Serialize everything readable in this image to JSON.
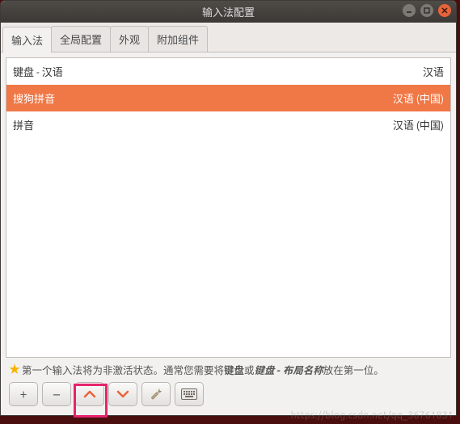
{
  "window": {
    "title": "输入法配置"
  },
  "tabs": [
    {
      "label": "输入法",
      "active": true
    },
    {
      "label": "全局配置",
      "active": false
    },
    {
      "label": "外观",
      "active": false
    },
    {
      "label": "附加组件",
      "active": false
    }
  ],
  "list": [
    {
      "name": "键盘 - 汉语",
      "lang": "汉语",
      "selected": false
    },
    {
      "name": "搜狗拼音",
      "lang": "汉语 (中国)",
      "selected": true
    },
    {
      "name": "拼音",
      "lang": "汉语 (中国)",
      "selected": false
    }
  ],
  "hint": {
    "pre": "第一个输入法将为非激活状态。通常您需要将",
    "bold1": "键盘",
    "mid": "或",
    "bold2": "键盘 - 布局名称",
    "post": "放在第一位。"
  },
  "toolbar": {
    "add": "+",
    "remove": "−",
    "up": "up-icon",
    "down": "down-icon",
    "config": "config-icon",
    "keyboard": "keyboard-icon"
  },
  "watermark": "https://blog.csdn.net/qq_36761831",
  "colors": {
    "selection": "#f07746",
    "highlight": "#e6246c"
  }
}
